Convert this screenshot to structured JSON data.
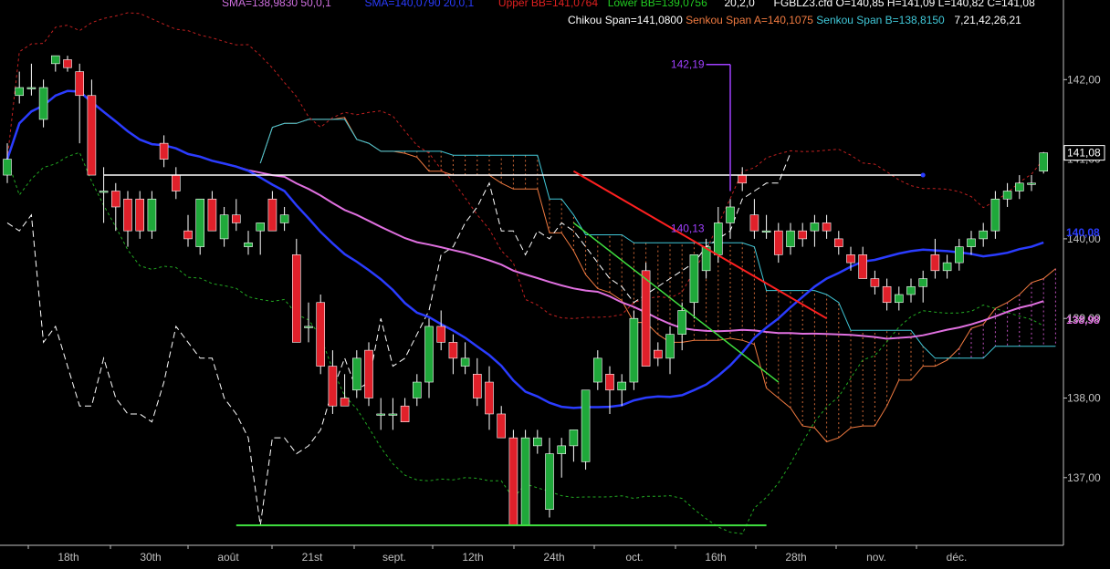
{
  "header": {
    "row1": [
      {
        "text": "SMA=138,9830  50,0,1",
        "color": "#d070e0"
      },
      {
        "text": "SMA=140,0790  20,0,1",
        "color": "#2a3cff"
      },
      {
        "text": "Upper BB=141,0764",
        "color": "#e02020"
      },
      {
        "text": "Lower BB=139,0756",
        "color": "#22cc22"
      },
      {
        "text": "20,2,0",
        "color": "#ffffff"
      },
      {
        "text": "FGBLZ3.cfd O=140,85 H=141,09 L=140,82 C=141,08",
        "color": "#ffffff"
      }
    ],
    "row2": [
      {
        "text": "Chikou Span=141,0800",
        "color": "#ffffff"
      },
      {
        "text": "Senkou Span A=140,1075",
        "color": "#f07a40"
      },
      {
        "text": "Senkou Span B=138,8150",
        "color": "#40c8d8"
      },
      {
        "text": "7,21,42,26,21",
        "color": "#ffffff"
      }
    ]
  },
  "colors": {
    "background": "#000000",
    "axis": "#c0c0c0",
    "up_candle": "#1fa83a",
    "down_candle": "#e0202a",
    "sma20": "#2a3cff",
    "sma50": "#e070e0",
    "upper_bb": "#c02020",
    "lower_bb": "#22aa22",
    "chikou": "#ffffff",
    "senkou_a": "#f07a40",
    "senkou_b": "#40c8d8",
    "cloud_bull": "#e060e0",
    "support": "#40e040",
    "resistance": "#ff2020",
    "trend_low": "#40e040",
    "swing_mark": "#a040ff",
    "last_price_box": "#ffffff"
  },
  "chart_data": {
    "type": "candlestick",
    "instrument": "FGBLZ3.cfd",
    "ylim": [
      136.15,
      143.0
    ],
    "y_ticks": [
      "142,00",
      "141,00",
      "140,00",
      "139,00",
      "138,00",
      "137,00"
    ],
    "x_labels": [
      "18th",
      "30th",
      "août",
      "21st",
      "sept.",
      "12th",
      "24th",
      "oct.",
      "16th",
      "28th",
      "nov.",
      "déc."
    ],
    "price_labels": {
      "last": "141,08",
      "sma20": "140,08",
      "sma50": "138,98"
    },
    "annotations": [
      {
        "text": "142,19",
        "value": 142.19
      },
      {
        "text": "140,13",
        "value": 140.13
      }
    ],
    "candles": [
      [
        140.8,
        141.2,
        140.7,
        141.0
      ],
      [
        141.8,
        142.1,
        141.7,
        141.9
      ],
      [
        141.9,
        142.2,
        141.8,
        141.9
      ],
      [
        141.5,
        142.0,
        141.4,
        141.9
      ],
      [
        142.2,
        142.3,
        142.1,
        142.3
      ],
      [
        142.25,
        142.3,
        142.1,
        142.15
      ],
      [
        142.1,
        142.2,
        141.2,
        141.8
      ],
      [
        141.8,
        142.0,
        140.8,
        140.8
      ],
      [
        140.6,
        140.9,
        140.2,
        140.6
      ],
      [
        140.6,
        140.7,
        140.1,
        140.4
      ],
      [
        140.5,
        140.6,
        139.9,
        140.1
      ],
      [
        140.5,
        140.6,
        140.0,
        140.1
      ],
      [
        140.1,
        140.6,
        140.0,
        140.5
      ],
      [
        141.2,
        141.3,
        140.9,
        141.0
      ],
      [
        140.8,
        140.9,
        140.5,
        140.6
      ],
      [
        140.1,
        140.3,
        139.9,
        140.0
      ],
      [
        139.9,
        140.4,
        139.8,
        140.5
      ],
      [
        140.5,
        140.6,
        140.1,
        140.1
      ],
      [
        140.0,
        140.4,
        139.9,
        140.3
      ],
      [
        140.3,
        140.5,
        140.1,
        140.2
      ],
      [
        139.9,
        140.1,
        139.8,
        139.95
      ],
      [
        140.1,
        140.2,
        139.8,
        140.2
      ],
      [
        140.5,
        140.6,
        140.1,
        140.1
      ],
      [
        140.2,
        140.4,
        140.1,
        140.3
      ],
      [
        139.8,
        140.0,
        138.7,
        138.7
      ],
      [
        138.9,
        139.2,
        138.7,
        138.9
      ],
      [
        139.2,
        139.3,
        138.3,
        138.4
      ],
      [
        138.4,
        138.6,
        137.8,
        137.9
      ],
      [
        138.0,
        138.3,
        137.9,
        137.9
      ],
      [
        138.1,
        138.6,
        138.0,
        138.5
      ],
      [
        138.6,
        138.7,
        137.9,
        138.0
      ],
      [
        137.8,
        138.0,
        137.6,
        137.8
      ],
      [
        137.8,
        138.0,
        137.6,
        137.8
      ],
      [
        137.9,
        138.0,
        137.7,
        137.7
      ],
      [
        138.0,
        138.3,
        137.9,
        138.2
      ],
      [
        138.2,
        139.0,
        138.0,
        138.9
      ],
      [
        138.9,
        139.1,
        138.6,
        138.7
      ],
      [
        138.7,
        138.8,
        138.3,
        138.5
      ],
      [
        138.4,
        138.7,
        138.3,
        138.5
      ],
      [
        138.3,
        138.5,
        137.9,
        138.0
      ],
      [
        138.2,
        138.4,
        137.6,
        137.8
      ],
      [
        137.8,
        137.9,
        137.5,
        137.5
      ],
      [
        137.5,
        137.6,
        136.4,
        136.4
      ],
      [
        136.4,
        137.6,
        136.4,
        137.5
      ],
      [
        137.4,
        137.6,
        137.3,
        137.5
      ],
      [
        136.6,
        137.5,
        136.5,
        137.3
      ],
      [
        137.3,
        137.5,
        137.0,
        137.4
      ],
      [
        137.4,
        137.6,
        137.2,
        137.6
      ],
      [
        137.2,
        138.1,
        137.1,
        138.1
      ],
      [
        138.2,
        138.6,
        138.1,
        138.5
      ],
      [
        138.3,
        138.4,
        137.8,
        138.1
      ],
      [
        138.1,
        138.3,
        137.9,
        138.2
      ],
      [
        138.2,
        139.1,
        138.1,
        139.0
      ],
      [
        139.6,
        139.7,
        138.4,
        138.4
      ],
      [
        138.6,
        138.7,
        138.4,
        138.5
      ],
      [
        138.5,
        138.9,
        138.3,
        138.8
      ],
      [
        138.8,
        139.2,
        138.6,
        139.1
      ],
      [
        139.2,
        139.8,
        139.0,
        139.8
      ],
      [
        139.6,
        140.0,
        139.5,
        139.9
      ],
      [
        139.8,
        140.4,
        139.7,
        140.2
      ],
      [
        140.2,
        140.5,
        140.0,
        140.4
      ],
      [
        140.8,
        140.9,
        140.6,
        140.7
      ],
      [
        140.3,
        140.5,
        140.0,
        140.1
      ],
      [
        140.1,
        140.3,
        140.0,
        140.1
      ],
      [
        140.1,
        140.2,
        139.7,
        139.8
      ],
      [
        139.9,
        140.2,
        139.8,
        140.1
      ],
      [
        140.1,
        140.2,
        139.9,
        140.0
      ],
      [
        140.1,
        140.3,
        139.9,
        140.2
      ],
      [
        140.2,
        140.3,
        140.0,
        140.1
      ],
      [
        140.0,
        140.1,
        139.8,
        139.9
      ],
      [
        139.8,
        139.9,
        139.6,
        139.7
      ],
      [
        139.8,
        139.9,
        139.5,
        139.5
      ],
      [
        139.5,
        139.6,
        139.3,
        139.4
      ],
      [
        139.4,
        139.5,
        139.1,
        139.2
      ],
      [
        139.2,
        139.4,
        139.1,
        139.3
      ],
      [
        139.3,
        139.5,
        139.2,
        139.4
      ],
      [
        139.4,
        139.6,
        139.2,
        139.5
      ],
      [
        139.8,
        140.0,
        139.5,
        139.6
      ],
      [
        139.6,
        139.8,
        139.5,
        139.7
      ],
      [
        139.7,
        140.0,
        139.6,
        139.9
      ],
      [
        139.9,
        140.1,
        139.8,
        140.0
      ],
      [
        140.0,
        140.2,
        139.9,
        140.1
      ],
      [
        140.1,
        140.6,
        140.0,
        140.5
      ],
      [
        140.5,
        140.7,
        140.4,
        140.6
      ],
      [
        140.6,
        140.8,
        140.5,
        140.7
      ],
      [
        140.7,
        140.8,
        140.6,
        140.7
      ],
      [
        140.85,
        141.09,
        140.82,
        141.08
      ]
    ]
  }
}
